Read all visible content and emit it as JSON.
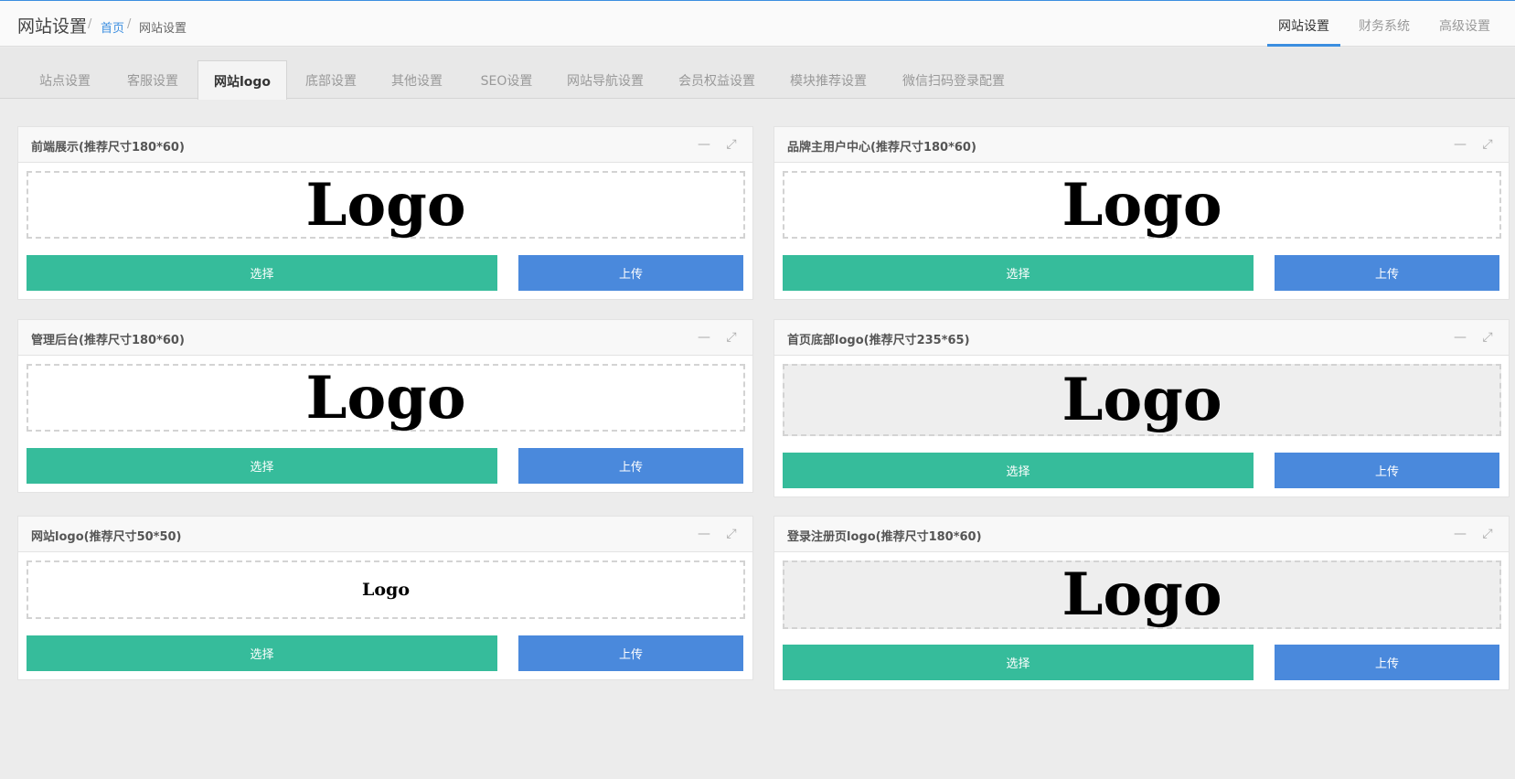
{
  "header": {
    "title": "网站设置",
    "breadcrumb_sep": "/",
    "breadcrumb_home": "首页",
    "breadcrumb_current": "网站设置",
    "top_tabs": [
      "网站设置",
      "财务系统",
      "高级设置"
    ]
  },
  "sub_tabs": [
    "站点设置",
    "客服设置",
    "网站logo",
    "底部设置",
    "其他设置",
    "SEO设置",
    "网站导航设置",
    "会员权益设置",
    "模块推荐设置",
    "微信扫码登录配置"
  ],
  "panels": [
    {
      "title": "前端展示(推荐尺寸180*60)",
      "logo_text": "Logo",
      "select_label": "选择",
      "upload_label": "上传"
    },
    {
      "title": "品牌主用户中心(推荐尺寸180*60)",
      "logo_text": "Logo",
      "select_label": "选择",
      "upload_label": "上传"
    },
    {
      "title": "管理后台(推荐尺寸180*60)",
      "logo_text": "Logo",
      "select_label": "选择",
      "upload_label": "上传"
    },
    {
      "title": "首页底部logo(推荐尺寸235*65)",
      "logo_text": "Logo",
      "select_label": "选择",
      "upload_label": "上传"
    },
    {
      "title": "网站logo(推荐尺寸50*50)",
      "logo_text": "Logo",
      "select_label": "选择",
      "upload_label": "上传"
    },
    {
      "title": "登录注册页logo(推荐尺寸180*60)",
      "logo_text": "Logo",
      "select_label": "选择",
      "upload_label": "上传"
    }
  ],
  "icons": {
    "minimize": "minimize-icon",
    "collapse": "compress-icon"
  },
  "colors": {
    "accent": "#3b8ee0",
    "select_button": "#36bc9b",
    "upload_button": "#4a89dc"
  }
}
